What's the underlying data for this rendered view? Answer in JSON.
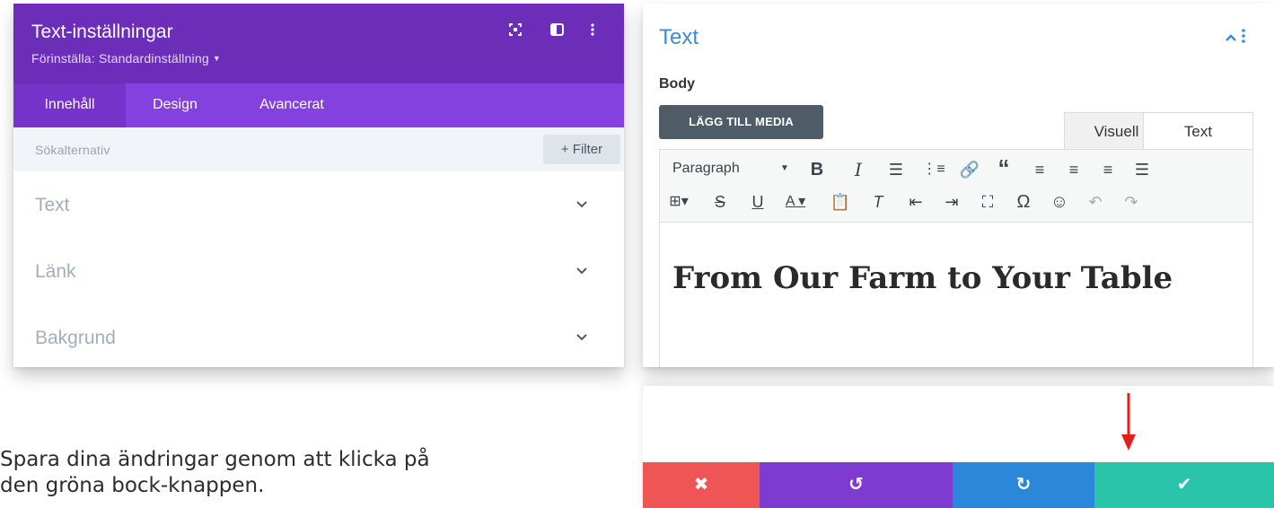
{
  "settings_panel": {
    "title": "Text-inställningar",
    "preset_label": "Förinställa: Standardinställning",
    "tabs": [
      {
        "label": "Innehåll",
        "active": true
      },
      {
        "label": "Design",
        "active": false
      },
      {
        "label": "Avancerat",
        "active": false
      }
    ],
    "search_placeholder": "Sökalternativ",
    "filter_label": "+ Filter",
    "sections": [
      "Text",
      "Länk",
      "Bakgrund"
    ],
    "colors": {
      "header": "#6c2eb9",
      "tabs": "#8540e0",
      "active_tab": "#7534c9"
    },
    "icons": [
      "expand-icon",
      "split-view-icon",
      "kebab-menu-icon",
      "chevron-down-icon"
    ]
  },
  "text_module": {
    "title": "Text",
    "body_label": "Body",
    "add_media_label": "LÄGG TILL MEDIA",
    "editor_tabs": [
      "Visuell",
      "Text"
    ],
    "format_select": "Paragraph",
    "content_heading": "From Our Farm to Your Table",
    "accent_color": "#3b8ad6"
  },
  "instruction": {
    "line1": "Spara dina ändringar genom att klicka på",
    "line2": "den gröna bock-knappen."
  },
  "action_bar": {
    "buttons": [
      {
        "name": "discard",
        "icon": "close-icon",
        "glyph": "✖",
        "color": "#ef5555"
      },
      {
        "name": "undo",
        "icon": "undo-icon",
        "glyph": "↺",
        "color": "#7e3bd0"
      },
      {
        "name": "redo",
        "icon": "redo-icon",
        "glyph": "↻",
        "color": "#2b87da"
      },
      {
        "name": "save",
        "icon": "checkmark-icon",
        "glyph": "✔",
        "color": "#29c4a9"
      }
    ],
    "arrow_color": "#e31e1e"
  }
}
